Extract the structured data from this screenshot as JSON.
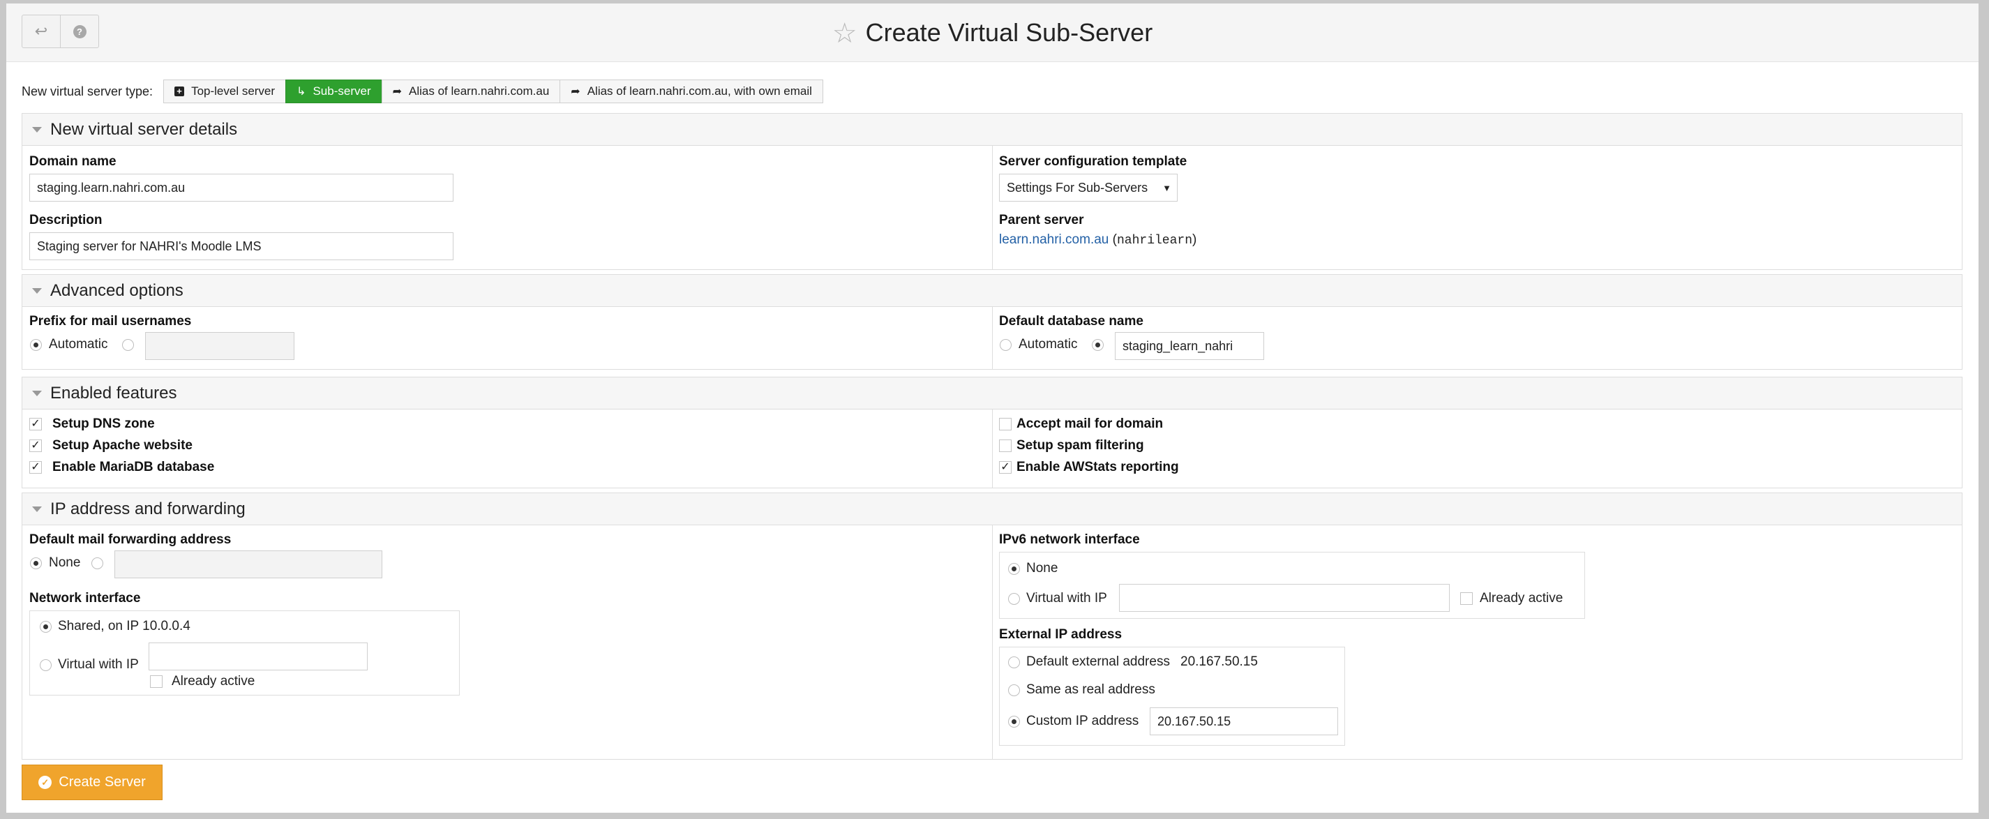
{
  "header": {
    "title": "Create Virtual Sub-Server",
    "back_icon": "undo-arrow-icon",
    "help_icon": "question-circle-icon",
    "title_icon": "star-outline-icon"
  },
  "server_type": {
    "label": "New virtual server type:",
    "options": [
      {
        "label": "Top-level server",
        "icon": "plus-square-icon",
        "active": false
      },
      {
        "label": "Sub-server",
        "icon": "level-down-arrow-icon",
        "active": true
      },
      {
        "label": "Alias of learn.nahri.com.au",
        "icon": "share-arrow-icon",
        "active": false
      },
      {
        "label": "Alias of learn.nahri.com.au, with own email",
        "icon": "share-arrow-icon",
        "active": false
      }
    ]
  },
  "details": {
    "heading": "New virtual server details",
    "domain_label": "Domain name",
    "domain_value": "staging.learn.nahri.com.au",
    "description_label": "Description",
    "description_value": "Staging server for NAHRI's Moodle LMS",
    "template_label": "Server configuration template",
    "template_value": "Settings For Sub-Servers",
    "parent_label": "Parent server",
    "parent_link": "learn.nahri.com.au",
    "parent_user_open": "(",
    "parent_user": "nahrilearn",
    "parent_user_close": ")"
  },
  "advanced": {
    "heading": "Advanced options",
    "prefix_label": "Prefix for mail usernames",
    "prefix_auto_label": "Automatic",
    "prefix_value": "",
    "db_label": "Default database name",
    "db_auto_label": "Automatic",
    "db_value": "staging_learn_nahri"
  },
  "features": {
    "heading": "Enabled features",
    "left": [
      {
        "label": "Setup DNS zone",
        "checked": true
      },
      {
        "label": "Setup Apache website",
        "checked": true
      },
      {
        "label": "Enable MariaDB database",
        "checked": true
      }
    ],
    "right": [
      {
        "label": "Accept mail for domain",
        "checked": false
      },
      {
        "label": "Setup spam filtering",
        "checked": false
      },
      {
        "label": "Enable AWStats reporting",
        "checked": true
      }
    ]
  },
  "ip": {
    "heading": "IP address and forwarding",
    "fwd_label": "Default mail forwarding address",
    "fwd_none_label": "None",
    "fwd_value": "",
    "netif_label": "Network interface",
    "netif_shared_label": "Shared, on IP 10.0.0.4",
    "netif_virtual_label": "Virtual with IP",
    "netif_virtual_value": "",
    "netif_active_label": "Already active",
    "ipv6_label": "IPv6 network interface",
    "ipv6_none_label": "None",
    "ipv6_virtual_label": "Virtual with IP",
    "ipv6_virtual_value": "",
    "ipv6_active_label": "Already active",
    "ext_label": "External IP address",
    "ext_default_label": "Default external address",
    "ext_default_value": "20.167.50.15",
    "ext_same_label": "Same as real address",
    "ext_custom_label": "Custom IP address",
    "ext_custom_value": "20.167.50.15"
  },
  "actions": {
    "create_label": "Create Server",
    "create_icon": "check-circle-icon"
  }
}
